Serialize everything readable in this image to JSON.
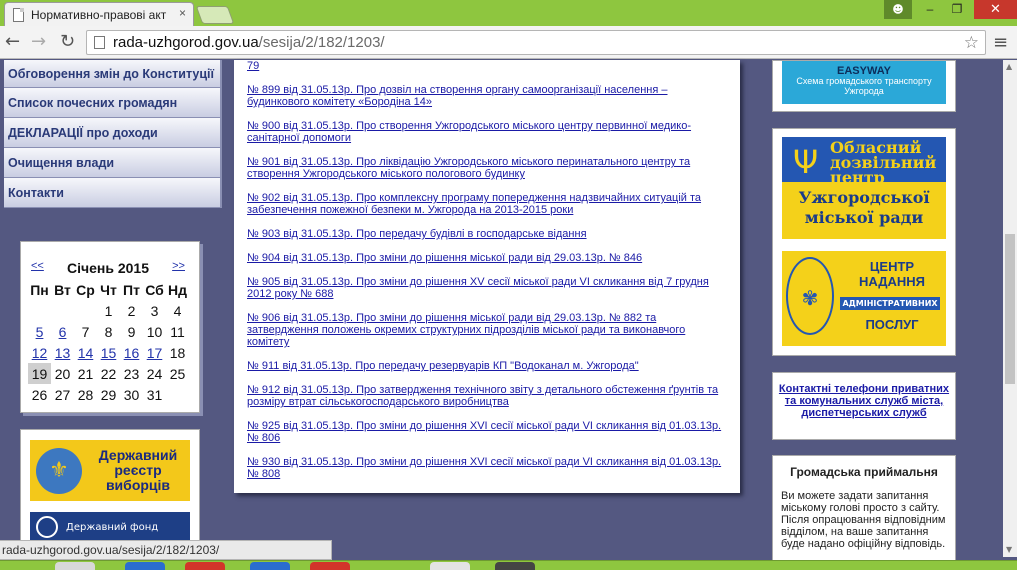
{
  "browser": {
    "tab_title": "Нормативно-правові акт",
    "tab_close": "×",
    "user_icon": "user-icon",
    "minimize": "–",
    "maximize": "❐",
    "close": "✕",
    "url_host": "rada-uzhgorod.gov.ua",
    "url_path": "/sesija/2/182/1203/",
    "back": "←",
    "forward": "→",
    "reload": "↻",
    "star": "☆",
    "menu": "≡",
    "status_url": "rada-uzhgorod.gov.ua/sesija/2/182/1203/"
  },
  "left_menu": [
    "Обговорення змін до Конституції",
    "Список почесних громадян",
    "ДЕКЛАРАЦІЇ про доходи",
    "Очищення влади",
    "Контакти"
  ],
  "calendar": {
    "prev": "<<",
    "next": ">>",
    "month": "Січень 2015",
    "weekdays": [
      "Пн",
      "Вт",
      "Ср",
      "Чт",
      "Пт",
      "Сб",
      "Нд"
    ],
    "weeks": [
      [
        "",
        "",
        "",
        "1",
        "2",
        "3",
        "4"
      ],
      [
        "5",
        "6",
        "7",
        "8",
        "9",
        "10",
        "11"
      ],
      [
        "12",
        "13",
        "14",
        "15",
        "16",
        "17",
        "18"
      ],
      [
        "19",
        "20",
        "21",
        "22",
        "23",
        "24",
        "25"
      ],
      [
        "26",
        "27",
        "28",
        "29",
        "30",
        "31",
        ""
      ]
    ],
    "linked_days": [
      "5",
      "6",
      "12",
      "13",
      "14",
      "15",
      "16",
      "17"
    ],
    "today": "19"
  },
  "banners_left": {
    "voters": "Державний реєстр виборців",
    "fund": "Державний фонд"
  },
  "documents": [
    "79",
    "№ 899 від 31.05.13р. Про дозвіл на створення органу самоорганізації населення – будинкового комітету «Бородіна 14»",
    "№ 900 від 31.05.13р. Про створення Ужгородського міського центру первинної медико-санітарної допомоги",
    "№ 901 від 31.05.13р. Про ліквідацію Ужгородського міського перинатального центру та створення Ужгородського міського пологового будинку",
    "№ 902 від 31.05.13р. Про комплексну програму попередження надзвичайних ситуацій та забезпечення пожежної безпеки м. Ужгорода на 2013-2015 роки",
    "№ 903 від 31.05.13р. Про передачу будівлі в господарське відання",
    "№ 904 від 31.05.13р. Про зміни до рішення міської ради від 29.03.13р. № 846",
    "№ 905 від 31.05.13р. Про зміни до рішення XV сесії міської ради VI скликання від 7 грудня 2012 року № 688",
    "№ 906 від 31.05.13р. Про зміни до рішення міської ради від 29.03.13р. № 882 та затвердження положень окремих структурних підрозділів міської ради та виконавчого комітету",
    "№ 911 від 31.05.13р. Про передачу резервуарів КП \"Водоканал м. Ужгорода\"",
    "№ 912 від 31.05.13р. Про затвердження технічного звіту з детального обстеження ґрунтів та розміру втрат сільськогосподарського виробництва",
    "№ 925 від 31.05.13р. Про зміни до рішення XVI сесії міської ради VI скликання від 01.03.13р. № 806",
    "№ 930 від 31.05.13р. Про зміни до рішення XVI сесії міської ради VI скликання від 01.03.13р. № 808"
  ],
  "right": {
    "easyway_logo": "EASYWAY",
    "easyway_caption": "Схема громадського транспорту Ужгорода",
    "oblast_top": "Обласний дозвільний центр",
    "oblast_bottom": "Ужгородської міської ради",
    "cnap_line1": "ЦЕНТР",
    "cnap_line2": "НАДАННЯ",
    "cnap_line3": "АДМІНІСТРАТИВНИХ",
    "cnap_line4": "ПОСЛУГ",
    "phones": "Контактні телефони приватних та комунальних служб міста, диспетчерських служб",
    "reception_title": "Громадська приймальня",
    "reception_text": "Ви можете задати запитання міському голові просто з сайту. Після опрацювання відповідним відділом, на ваше запитання буде надано офіційну відповідь."
  },
  "colors": {
    "page_bg": "#545881",
    "link": "#1a1aa6",
    "menu_text": "#2a3a78",
    "chrome_green": "#8ec63f"
  }
}
